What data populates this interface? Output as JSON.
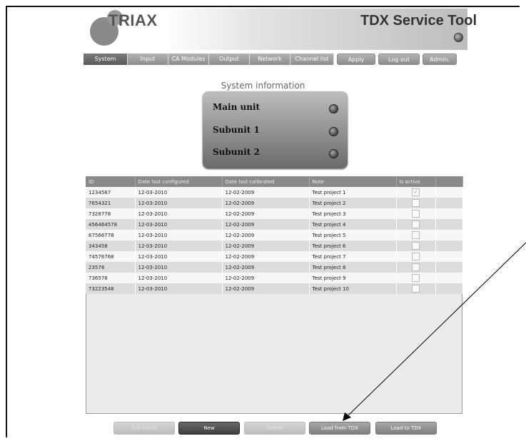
{
  "header": {
    "logo_text": "TRIAX",
    "app_title": "TDX Service Tool"
  },
  "nav": {
    "tabs": [
      "System",
      "Input",
      "CA Modules",
      "Output",
      "Network",
      "Channel list"
    ],
    "active_tab": "System",
    "apply_label": "Apply",
    "logout_label": "Log out",
    "admin_label": "Admin."
  },
  "system_info": {
    "title": "System information",
    "units": [
      "Main unit",
      "Subunit 1",
      "Subunit 2"
    ]
  },
  "table": {
    "columns": [
      "ID",
      "Date last configured",
      "Date last calibrated",
      "Note",
      "Is active"
    ],
    "rows": [
      {
        "id": "1234567",
        "configured": "12-03-2010",
        "calibrated": "12-02-2009",
        "note": "Test project 1",
        "active": true
      },
      {
        "id": "7654321",
        "configured": "12-03-2010",
        "calibrated": "12-02-2009",
        "note": "Test project 2",
        "active": false
      },
      {
        "id": "7328778",
        "configured": "12-03-2010",
        "calibrated": "12-02-2009",
        "note": "Test project 3",
        "active": false
      },
      {
        "id": "456464578",
        "configured": "12-03-2010",
        "calibrated": "12-02-2009",
        "note": "Test project 4",
        "active": false
      },
      {
        "id": "67566778",
        "configured": "12-03-2010",
        "calibrated": "12-02-2009",
        "note": "Test project 5",
        "active": false
      },
      {
        "id": "343458",
        "configured": "12-03-2010",
        "calibrated": "12-02-2009",
        "note": "Test project 6",
        "active": false
      },
      {
        "id": "74576768",
        "configured": "12-03-2010",
        "calibrated": "12-02-2009",
        "note": "Test project 7",
        "active": false
      },
      {
        "id": "23578",
        "configured": "12-03-2010",
        "calibrated": "12-02-2009",
        "note": "Test project 8",
        "active": false
      },
      {
        "id": "736578",
        "configured": "12-03-2010",
        "calibrated": "12-02-2009",
        "note": "Test project 9",
        "active": false
      },
      {
        "id": "73223548",
        "configured": "12-03-2010",
        "calibrated": "12-02-2009",
        "note": "Test project 10",
        "active": false
      }
    ]
  },
  "actions": {
    "set_active": "Set active",
    "new": "New",
    "delete": "Delete",
    "load_from_tdx": "Load from TDX",
    "load_to_tdx": "Load to TDX"
  }
}
